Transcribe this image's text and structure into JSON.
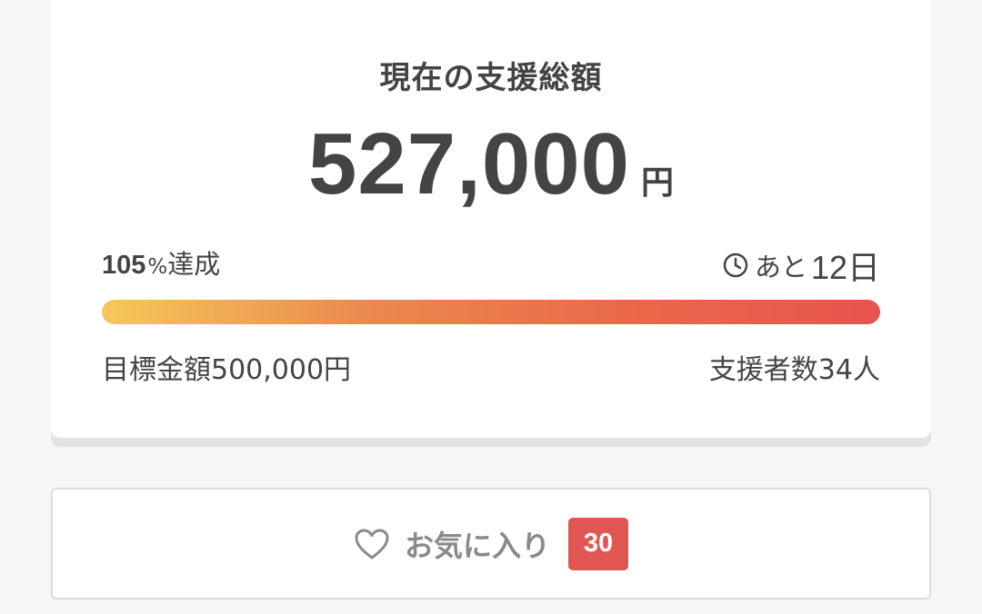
{
  "funding_card": {
    "title": "現在の支援総額",
    "amount": "527,000",
    "amount_unit": "円",
    "achievement_value": "105",
    "achievement_unit": "%",
    "achievement_suffix": "達成",
    "remaining_prefix": "あと",
    "remaining_days": "12日",
    "progress_percent": 105,
    "progress_gradient": [
      "#f5c85a",
      "#eb8a4e",
      "#e96a4a",
      "#e8534e"
    ],
    "goal_label": "目標金額500,000円",
    "backers_label": "支援者数34人"
  },
  "favorite_button": {
    "label": "お気に入り",
    "count": "30",
    "badge_color": "#e05652",
    "icon": "heart-outline-icon"
  },
  "icons": {
    "clock": "clock-icon",
    "heart": "heart-icon"
  }
}
